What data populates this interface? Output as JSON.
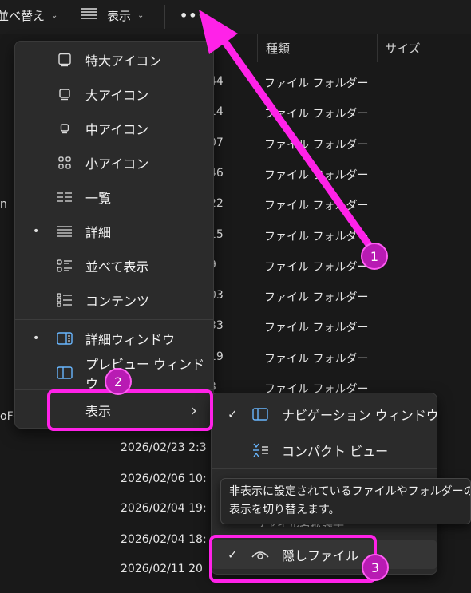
{
  "toolbar": {
    "sort_label": "並べ替え",
    "view_label": "表示",
    "more_label": "•••"
  },
  "columns": {
    "type": "種類",
    "size": "サイズ"
  },
  "rows": [
    {
      "date": "44",
      "type": "ファイル フォルダー"
    },
    {
      "date": "14",
      "type": "ファイル フォルダー"
    },
    {
      "date": "07",
      "type": "ファイル フォルダー"
    },
    {
      "date": "46",
      "type": "ファイル フォルダー"
    },
    {
      "date": "22",
      "type": "ファイル フォルダー"
    },
    {
      "date": "15",
      "type": "ファイル フォルダー"
    },
    {
      "date": "9",
      "type": "ファイル フォルダー"
    },
    {
      "date": "03",
      "type": "ファイル フォルダー"
    },
    {
      "date": "33",
      "type": "ファイル フォルダー"
    },
    {
      "date": "19",
      "type": "ファイル フォルダー"
    },
    {
      "date": "3",
      "type": "ファイル フォルダー"
    }
  ],
  "lower_dates": [
    "2026/02/23 2:3",
    "2026/02/06 10:",
    "2026/02/04 19:",
    "2026/02/04 18:",
    "2026/02/11 20"
  ],
  "left_fragments": {
    "n": "n",
    "ofo": "oFo"
  },
  "view_menu": {
    "items": [
      {
        "label": "特大アイコン",
        "icon": "monitor-xl-icon",
        "selected": false
      },
      {
        "label": "大アイコン",
        "icon": "monitor-large-icon",
        "selected": false
      },
      {
        "label": "中アイコン",
        "icon": "monitor-medium-icon",
        "selected": false
      },
      {
        "label": "小アイコン",
        "icon": "small-icons-grid-icon",
        "selected": false
      },
      {
        "label": "一覧",
        "icon": "list-icon",
        "selected": false
      },
      {
        "label": "詳細",
        "icon": "details-icon",
        "selected": true
      },
      {
        "label": "並べて表示",
        "icon": "tiles-icon",
        "selected": false
      },
      {
        "label": "コンテンツ",
        "icon": "content-icon",
        "selected": false
      }
    ],
    "pane_items": [
      {
        "label": "詳細ウィンドウ",
        "icon": "details-pane-icon",
        "selected": true
      },
      {
        "label": "プレビュー ウィンドウ",
        "icon": "preview-pane-icon",
        "selected": false
      }
    ],
    "show_label": "表示",
    "bullet": "•",
    "submenu_arrow": "›"
  },
  "show_submenu": {
    "navigation_pane": "ナビゲーション ウィンドウ",
    "compact_view": "コンパクト ビュー",
    "hidden_files": "隠しファイル",
    "check": "✓",
    "hidden_row_partial": "ファイル名拡張子"
  },
  "tooltip": {
    "line1": "非表示に設定されているファイルやフォルダーの",
    "line2": "表示を切り替えます。"
  },
  "annotations": {
    "color": "#ff22e8",
    "badge1": "1",
    "badge2": "2",
    "badge3": "3"
  }
}
